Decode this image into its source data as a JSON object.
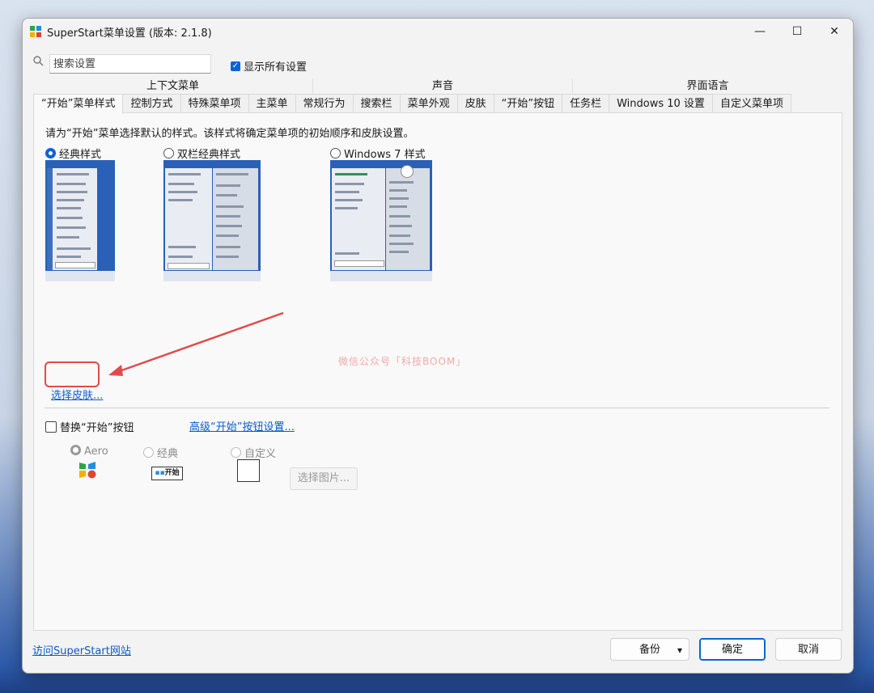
{
  "window": {
    "title": "SuperStart菜单设置 (版本: 2.1.8)"
  },
  "titlebar": {
    "minimize": "—",
    "maximize": "☐",
    "close": "✕"
  },
  "search": {
    "placeholder": "搜索设置",
    "value": ""
  },
  "show_all": {
    "label": "显示所有设置",
    "checked": true
  },
  "tab_groups": [
    {
      "label": "上下文菜单"
    },
    {
      "label": "声音"
    },
    {
      "label": "界面语言"
    }
  ],
  "tabs": [
    {
      "label": "“开始”菜单样式",
      "active": true
    },
    {
      "label": "控制方式"
    },
    {
      "label": "特殊菜单项"
    },
    {
      "label": "主菜单"
    },
    {
      "label": "常规行为"
    },
    {
      "label": "搜索栏"
    },
    {
      "label": "菜单外观"
    },
    {
      "label": "皮肤"
    },
    {
      "label": "“开始”按钮"
    },
    {
      "label": "任务栏"
    },
    {
      "label": "Windows 10 设置"
    },
    {
      "label": "自定义菜单项"
    }
  ],
  "style_page": {
    "instruction": "请为“开始”菜单选择默认的样式。该样式将确定菜单项的初始顺序和皮肤设置。",
    "options": [
      {
        "label": "经典样式",
        "selected": true
      },
      {
        "label": "双栏经典样式",
        "selected": false
      },
      {
        "label": "Windows 7 样式",
        "selected": false
      }
    ],
    "skin_link": "选择皮肤...",
    "watermark": "微信公众号「科技BOOM」"
  },
  "start_button": {
    "replace_label": "替换“开始”按钮",
    "replace_checked": false,
    "advanced_link": "高级“开始”按钮设置...",
    "styles": [
      {
        "label": "Aero",
        "selected": true
      },
      {
        "label": "经典",
        "selected": false
      },
      {
        "label": "自定义",
        "selected": false
      }
    ],
    "classic_preview_text": "开始",
    "pick_image_button": "选择图片..."
  },
  "footer": {
    "website_link": "访问SuperStart网站",
    "backup_button": "备份",
    "backup_dropdown": "▾",
    "ok_button": "确定",
    "cancel_button": "取消"
  },
  "colors": {
    "accent": "#0a64d6",
    "link": "#0b5cc9",
    "annotation": "#e24a4a",
    "watermark": "#f2a8a8"
  }
}
